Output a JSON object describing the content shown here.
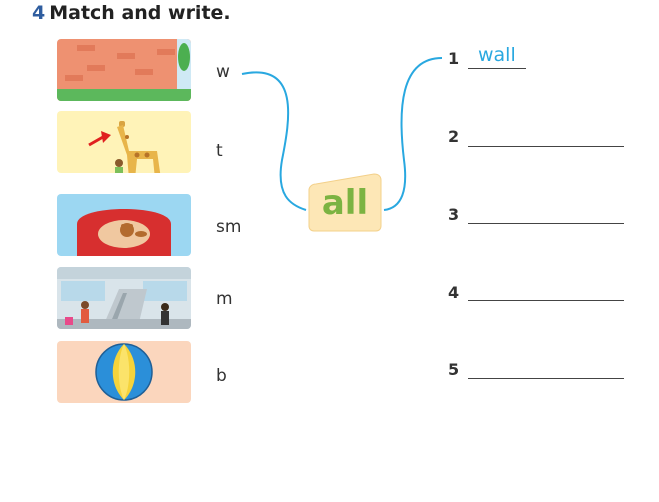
{
  "exercise": {
    "number": "4",
    "title": "Match and write."
  },
  "pictures": [
    {
      "name": "wall"
    },
    {
      "name": "tall-giraffe"
    },
    {
      "name": "small-animal"
    },
    {
      "name": "mall"
    },
    {
      "name": "ball"
    }
  ],
  "stems": [
    "w",
    "t",
    "sm",
    "m",
    "b"
  ],
  "suffix": "all",
  "answers": [
    {
      "number": "1",
      "value": "wall"
    },
    {
      "number": "2",
      "value": ""
    },
    {
      "number": "3",
      "value": ""
    },
    {
      "number": "4",
      "value": ""
    },
    {
      "number": "5",
      "value": ""
    }
  ],
  "colors": {
    "title_number": "#2f5d9f",
    "suffix": "#7cb342",
    "answer_ink": "#29a8e0",
    "connector": "#29a8e0"
  }
}
